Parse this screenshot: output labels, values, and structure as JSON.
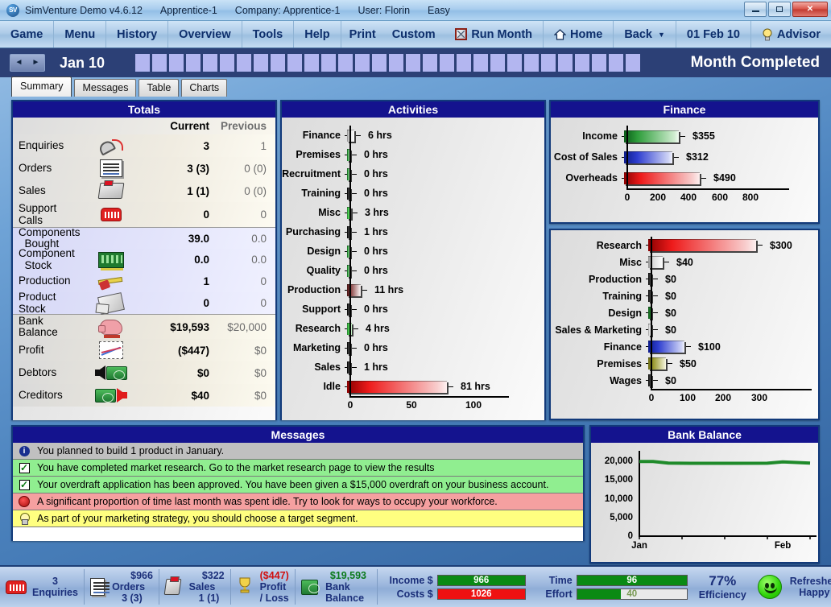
{
  "titlebar": {
    "app": "SimVenture Demo v4.6.12",
    "profile": "Apprentice-1",
    "company": "Company: Apprentice-1",
    "user": "User: Florin",
    "difficulty": "Easy",
    "logo": "sv-logo",
    "minimize": "minimize-icon",
    "maximize": "maximize-icon",
    "close": "✕"
  },
  "menu": {
    "items": [
      "Game",
      "Menu",
      "History",
      "Overview",
      "Tools",
      "Help",
      "Print",
      "Custom"
    ],
    "run_month": "Run Month",
    "home": "Home",
    "back": "Back",
    "date": "01 Feb 10",
    "advisor": "Advisor"
  },
  "monthbar": {
    "prev": "◄",
    "next": "►",
    "month": "Jan 10",
    "status": "Month Completed",
    "progress_blocks": 30
  },
  "tabs": [
    {
      "label": "Summary",
      "active": true
    },
    {
      "label": "Messages",
      "active": false
    },
    {
      "label": "Table",
      "active": false
    },
    {
      "label": "Charts",
      "active": false
    }
  ],
  "totals": {
    "title": "Totals",
    "col_current": "Current",
    "col_previous": "Previous",
    "rows": [
      {
        "label": "Enquiries",
        "icon": "phone-icon",
        "current": "3",
        "previous": "1",
        "section": "a"
      },
      {
        "label": "Orders",
        "icon": "order-doc-icon",
        "current": "3 (3)",
        "previous": "0 (0)",
        "section": "a"
      },
      {
        "label": "Sales",
        "icon": "cash-register-icon",
        "current": "1 (1)",
        "previous": "0 (0)",
        "section": "a"
      },
      {
        "label": "Support\nCalls",
        "icon": "red-phone-icon",
        "current": "0",
        "previous": "0",
        "section": "a"
      },
      {
        "label": "Components\n  Bought",
        "icon": "",
        "current": "39.0",
        "previous": "0.0",
        "section": "b"
      },
      {
        "label": "Component\n  Stock",
        "icon": "circuit-board-icon",
        "current": "0.0",
        "previous": "0.0",
        "section": "b"
      },
      {
        "label": "Production",
        "icon": "tools-icon",
        "current": "1",
        "previous": "0",
        "section": "b"
      },
      {
        "label": "Product\nStock",
        "icon": "product-stock-icon",
        "current": "0",
        "previous": "0",
        "section": "b"
      },
      {
        "label": "Bank\nBalance",
        "icon": "piggy-bank-icon",
        "current": "$19,593",
        "previous": "$20,000",
        "section": "c"
      },
      {
        "label": "Profit",
        "icon": "line-chart-icon",
        "current": "($447)",
        "previous": "$0",
        "section": "c"
      },
      {
        "label": "Debtors",
        "icon": "money-in-icon",
        "current": "$0",
        "previous": "$0",
        "section": "c"
      },
      {
        "label": "Creditors",
        "icon": "money-out-icon",
        "current": "$40",
        "previous": "$0",
        "section": "c"
      }
    ]
  },
  "messages": {
    "title": "Messages",
    "items": [
      {
        "type": "info",
        "icon": "info-icon",
        "text": "You planned to build 1 product in January."
      },
      {
        "type": "ok",
        "icon": "check-icon",
        "text": "You have completed market research. Go to the market research page to view the results"
      },
      {
        "type": "ok",
        "icon": "check-icon",
        "text": "Your overdraft application has been approved. You have been given a $15,000 overdraft on your business account."
      },
      {
        "type": "alert",
        "icon": "stop-icon",
        "text": "A significant proportion of time last month was spent idle. Try to look for ways to occupy your workforce."
      },
      {
        "type": "tip",
        "icon": "bulb-icon",
        "text": "As part of your marketing strategy, you should choose a target segment."
      }
    ]
  },
  "statusbar": {
    "enquiries": {
      "label": "Enquiries",
      "value": "3",
      "icon": "red-phone-icon"
    },
    "orders": {
      "label": "Orders",
      "amount": "$966",
      "count": "3 (3)",
      "icon": "order-doc-icon"
    },
    "sales": {
      "label": "Sales",
      "amount": "$322",
      "count": "1 (1)",
      "icon": "cash-register-icon"
    },
    "profit": {
      "label": "Profit / Loss",
      "amount": "($447)",
      "icon": "trophy-icon"
    },
    "bank": {
      "label": "Bank Balance",
      "amount": "$19,593",
      "icon": "cash-icon"
    },
    "income": {
      "label": "Income $",
      "value": "966",
      "fill_pct": 100,
      "color": "#0a8a14"
    },
    "costs": {
      "label": "Costs $",
      "value": "1026",
      "fill_pct": 100,
      "color": "#ee1111"
    },
    "time": {
      "label": "Time",
      "value": "96",
      "fill_pct": 100,
      "color": "#0a8a14"
    },
    "effort": {
      "label": "Effort",
      "value": "40",
      "fill_pct": 40,
      "color": "#0a8a14"
    },
    "efficiency": {
      "value": "77%",
      "label": "Efficiency"
    },
    "mood": {
      "icon": "happy-face-icon",
      "line1": "Refreshed",
      "line2": "Happy"
    }
  },
  "chart_data": [
    {
      "id": "activities",
      "type": "bar",
      "orientation": "horizontal",
      "title": "Activities",
      "xlabel": "",
      "ylabel": "",
      "xlim": [
        0,
        110
      ],
      "xticks": [
        0,
        50,
        100
      ],
      "unit": "hrs",
      "categories": [
        "Finance",
        "Premises",
        "Recruitment",
        "Training",
        "Misc",
        "Purchasing",
        "Design",
        "Quality",
        "Production",
        "Support",
        "Research",
        "Marketing",
        "Sales",
        "Idle"
      ],
      "values": [
        6,
        0,
        0,
        0,
        3,
        1,
        0,
        0,
        11,
        0,
        4,
        0,
        1,
        81
      ],
      "value_labels": [
        "6 hrs",
        "0 hrs",
        "0 hrs",
        "0 hrs",
        "3 hrs",
        "1 hrs",
        "0 hrs",
        "0 hrs",
        "11 hrs",
        "0 hrs",
        "4 hrs",
        "0 hrs",
        "1 hrs",
        "81 hrs"
      ],
      "colors": [
        "white",
        "green",
        "green",
        "black",
        "lgreen",
        "black",
        "green",
        "green",
        "maroon",
        "black",
        "lgreen",
        "black",
        "black",
        "red"
      ]
    },
    {
      "id": "finance",
      "type": "bar",
      "orientation": "horizontal",
      "title": "Finance",
      "xlabel": "",
      "ylabel": "",
      "xlim": [
        0,
        900
      ],
      "xticks": [
        0,
        200,
        400,
        600,
        800
      ],
      "categories": [
        "Income",
        "Cost of Sales",
        "Overheads"
      ],
      "values": [
        355,
        312,
        490
      ],
      "value_labels": [
        "$355",
        "$312",
        "$490"
      ],
      "colors": [
        "green",
        "blue",
        "red"
      ]
    },
    {
      "id": "costs",
      "type": "bar",
      "orientation": "horizontal",
      "title": "",
      "xlabel": "",
      "ylabel": "",
      "xlim": [
        0,
        380
      ],
      "xticks": [
        0,
        100,
        200,
        300
      ],
      "categories": [
        "Research",
        "Misc",
        "Production",
        "Training",
        "Design",
        "Sales & Marketing",
        "Finance",
        "Premises",
        "Wages"
      ],
      "values": [
        300,
        40,
        0,
        0,
        0,
        0,
        100,
        50,
        0
      ],
      "value_labels": [
        "$300",
        "$40",
        "$0",
        "$0",
        "$0",
        "$0",
        "$100",
        "$50",
        "$0"
      ],
      "colors": [
        "red",
        "white",
        "black",
        "black",
        "dgreen",
        "white",
        "blue",
        "olive",
        "black"
      ]
    },
    {
      "id": "bank-balance",
      "type": "line",
      "title": "Bank Balance",
      "xlabel": "",
      "ylabel": "",
      "xticks": [
        "Jan",
        "Feb"
      ],
      "yticks": [
        "0",
        "5,000",
        "10,000",
        "15,000",
        "20,000"
      ],
      "ylim": [
        0,
        22000
      ],
      "series": [
        {
          "name": "Balance",
          "color": "#1f8a2a",
          "x": [
            0,
            0.08,
            0.17,
            0.3,
            0.55,
            0.75,
            0.84,
            1.0
          ],
          "values": [
            20000,
            20000,
            19560,
            19520,
            19530,
            19540,
            19900,
            19593
          ]
        }
      ]
    }
  ]
}
